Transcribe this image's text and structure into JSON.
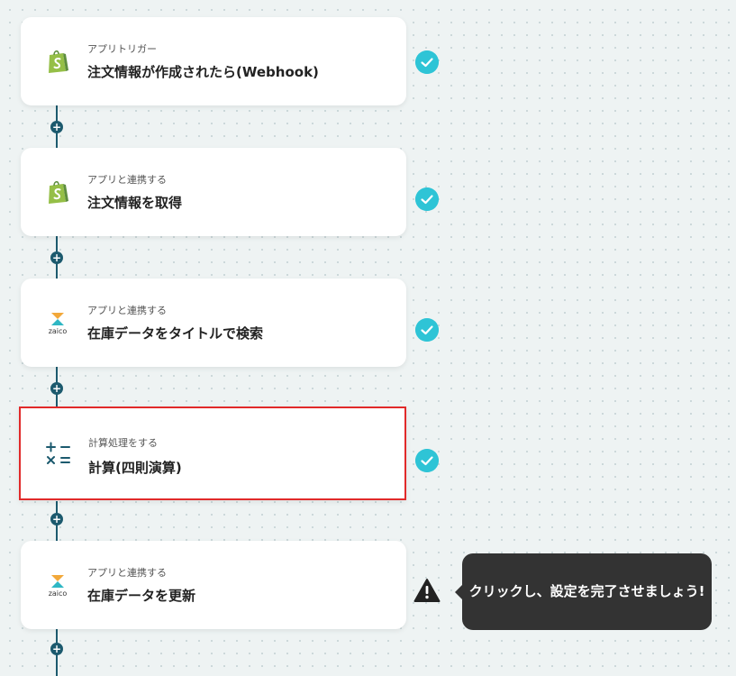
{
  "steps": [
    {
      "subtitle": "アプリトリガー",
      "title": "注文情報が作成されたら(Webhook)",
      "app": "shopify",
      "status": "done"
    },
    {
      "subtitle": "アプリと連携する",
      "title": "注文情報を取得",
      "app": "shopify",
      "status": "done"
    },
    {
      "subtitle": "アプリと連携する",
      "title": "在庫データをタイトルで検索",
      "app": "zaico",
      "status": "done"
    },
    {
      "subtitle": "計算処理をする",
      "title": "計算(四則演算)",
      "app": "calculator",
      "status": "done"
    },
    {
      "subtitle": "アプリと連携する",
      "title": "在庫データを更新",
      "app": "zaico",
      "status": "warning"
    }
  ],
  "zaico_label": "zaico",
  "tooltip": "クリックし、設定を完了させましょう!",
  "colors": {
    "connector": "#1c5a6e",
    "check": "#2ec4d6",
    "selected_border": "#e12a2a",
    "shopify_green": "#95bf47",
    "tooltip_bg": "#333333"
  }
}
